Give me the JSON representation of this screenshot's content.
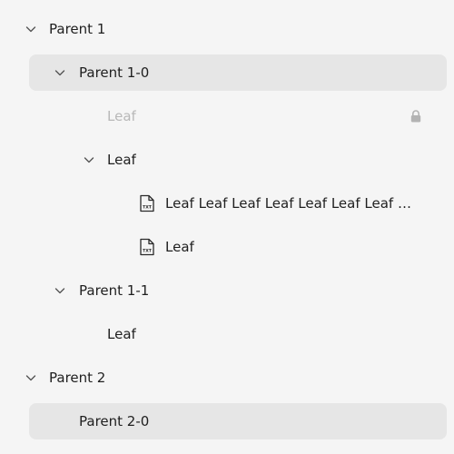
{
  "tree": {
    "parent1": "Parent 1",
    "parent1_0": "Parent 1-0",
    "leaf_disabled": "Leaf",
    "leaf_folder": "Leaf",
    "leaf_long": "Leaf Leaf Leaf Leaf Leaf Leaf Leaf Leaf",
    "leaf_file": "Leaf",
    "parent1_1": "Parent 1-1",
    "leaf_1_1": "Leaf",
    "parent2": "Parent 2",
    "parent2_0": "Parent 2-0",
    "file_badge": "TXT"
  },
  "colors": {
    "background": "#f5f5f5",
    "selected": "#e6e6e6",
    "text": "#1f1f1f",
    "disabled": "#b8b8b8"
  }
}
